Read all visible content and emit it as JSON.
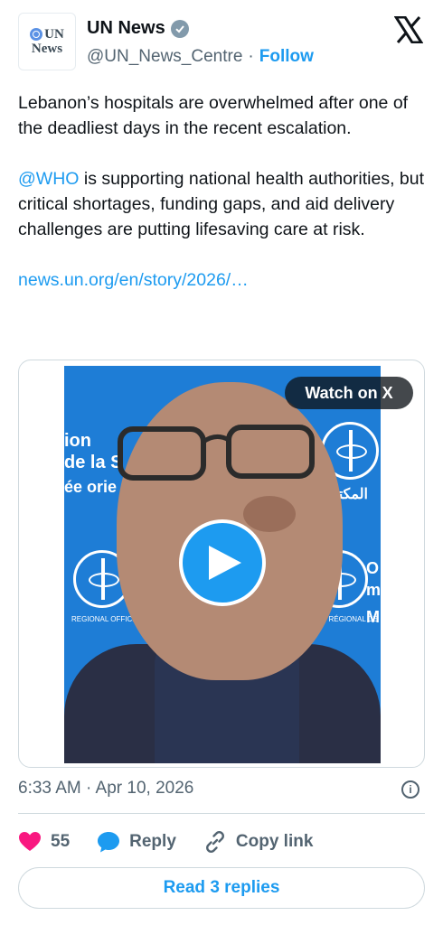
{
  "account": {
    "avatar_line1": "UN",
    "avatar_line2": "News",
    "display_name": "UN News",
    "handle": "@UN_News_Centre",
    "separator": "·",
    "follow_label": "Follow"
  },
  "tweet": {
    "paragraph1": "Lebanon’s hospitals are overwhelmed after one of the deadliest days in the recent escalation.",
    "mention": "@WHO",
    "paragraph2_rest": " is supporting national health authorities, but critical shortages, funding gaps, and aid delivery challenges are putting lifesaving care at risk.",
    "link": "news.un.org/en/story/2026/…"
  },
  "media": {
    "watch_label": "Watch on X",
    "overlay_left_1": "ion",
    "overlay_left_2": "de la S",
    "overlay_left_3": "ée orie",
    "overlay_right_arabic": "المكتب الإ",
    "overlay_right_1": "O",
    "overlay_right_2": "m",
    "overlay_right_3": "M",
    "caption_left": "REGIONAL OFFICE FOR TH",
    "caption_right": "REAU RÉGIONAL DE LA"
  },
  "meta": {
    "timestamp": "6:33 AM · Apr 10, 2026",
    "info_icon_label": "i"
  },
  "actions": {
    "like_count": "55",
    "reply_label": "Reply",
    "copy_label": "Copy link",
    "read_replies_label": "Read 3 replies"
  },
  "colors": {
    "accent": "#1d9bf0",
    "like": "#f91880",
    "text": "#0f1419",
    "secondary": "#536471",
    "border": "#cfd9de",
    "video_bg": "#1e7dd6"
  }
}
